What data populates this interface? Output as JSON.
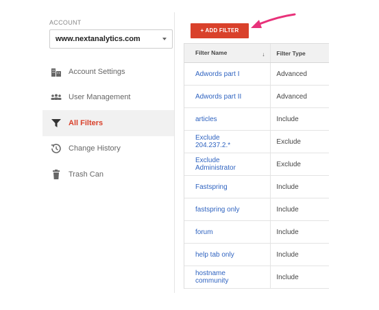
{
  "sidebar": {
    "account_label": "ACCOUNT",
    "account_value": "www.nextanalytics.com",
    "items": [
      {
        "label": "Account Settings",
        "icon": "building-icon"
      },
      {
        "label": "User Management",
        "icon": "users-icon"
      },
      {
        "label": "All Filters",
        "icon": "filter-icon",
        "active": true
      },
      {
        "label": "Change History",
        "icon": "history-icon"
      },
      {
        "label": "Trash Can",
        "icon": "trash-icon"
      }
    ]
  },
  "main": {
    "add_button": "+ ADD FILTER",
    "table": {
      "columns": [
        "Filter Name",
        "Filter Type"
      ],
      "sort_indicator": "↓",
      "rows": [
        {
          "name": "Adwords part I",
          "type": "Advanced"
        },
        {
          "name": "Adwords part II",
          "type": "Advanced"
        },
        {
          "name": "articles",
          "type": "Include"
        },
        {
          "name": "Exclude\n204.237.2.*",
          "type": "Exclude"
        },
        {
          "name": "Exclude\nAdministrator",
          "type": "Exclude"
        },
        {
          "name": "Fastspring",
          "type": "Include"
        },
        {
          "name": "fastspring only",
          "type": "Include"
        },
        {
          "name": "forum",
          "type": "Include"
        },
        {
          "name": "help tab only",
          "type": "Include"
        },
        {
          "name": "hostname\ncommunity",
          "type": "Include"
        }
      ]
    }
  },
  "colors": {
    "accent": "#d9412b",
    "link": "#2f63c0",
    "annotation_arrow": "#e8327a"
  }
}
